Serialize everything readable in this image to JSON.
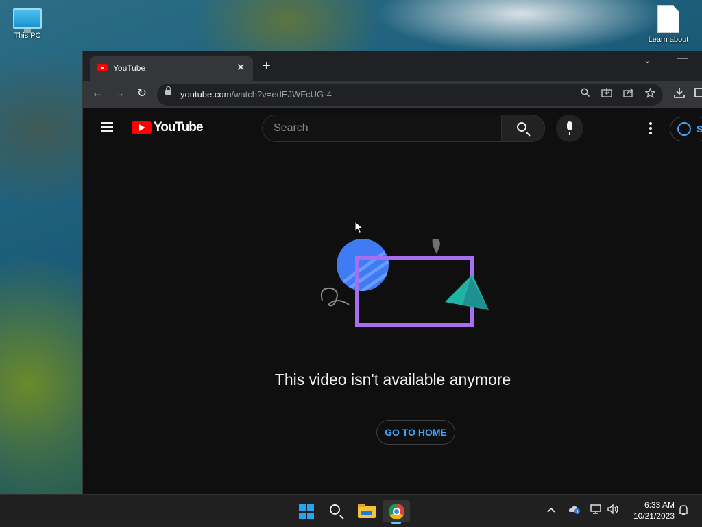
{
  "desktop": {
    "icons": [
      {
        "label": "This PC",
        "icon": "computer-icon"
      },
      {
        "label": "Learn about",
        "icon": "document-icon"
      }
    ]
  },
  "browser": {
    "tab": {
      "title": "YouTube",
      "favicon": "youtube-favicon",
      "close": "✕"
    },
    "new_tab": "+",
    "tab_search": "⌄",
    "minimize": "—",
    "toolbar": {
      "back": "←",
      "forward": "→",
      "reload": "↻",
      "url_host": "youtube.com",
      "url_path": "/watch?v=edEJWFcUG-4"
    }
  },
  "youtube": {
    "logo_text": "YouTube",
    "search_placeholder": "Search",
    "signin_label": "S",
    "message": "This video isn't available anymore",
    "home_button": "GO TO HOME"
  },
  "taskbar": {
    "apps": [
      "start-icon",
      "search-icon",
      "file-explorer-icon",
      "chrome-icon"
    ],
    "active_app": "chrome-icon",
    "tray": {
      "chevron": "^",
      "network": "▭",
      "volume": "🔊"
    },
    "time": "6:33 AM",
    "date": "10/21/2023"
  },
  "colors": {
    "youtube_red": "#ff0000",
    "link_blue": "#3ea6ff",
    "page_bg": "#0f0f0f"
  }
}
